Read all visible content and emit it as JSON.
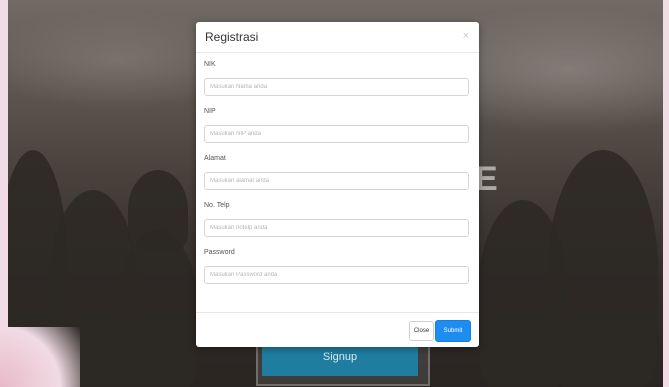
{
  "background": {
    "letter": "E",
    "signup_label": "Signup"
  },
  "modal": {
    "title": "Registrasi",
    "close_glyph": "×",
    "fields": [
      {
        "label": "NIK",
        "placeholder": "Masukan Nama anda"
      },
      {
        "label": "NIP",
        "placeholder": "Masukan NIP anda"
      },
      {
        "label": "Alamat",
        "placeholder": "Masukan alamat anda"
      },
      {
        "label": "No. Telp",
        "placeholder": "Masukan notelp anda"
      },
      {
        "label": "Password",
        "placeholder": "Masukan Password anda"
      }
    ],
    "close_label": "Close",
    "submit_label": "Submit"
  },
  "colors": {
    "submit": "#1d8ef0",
    "signup": "#1f7da0"
  }
}
